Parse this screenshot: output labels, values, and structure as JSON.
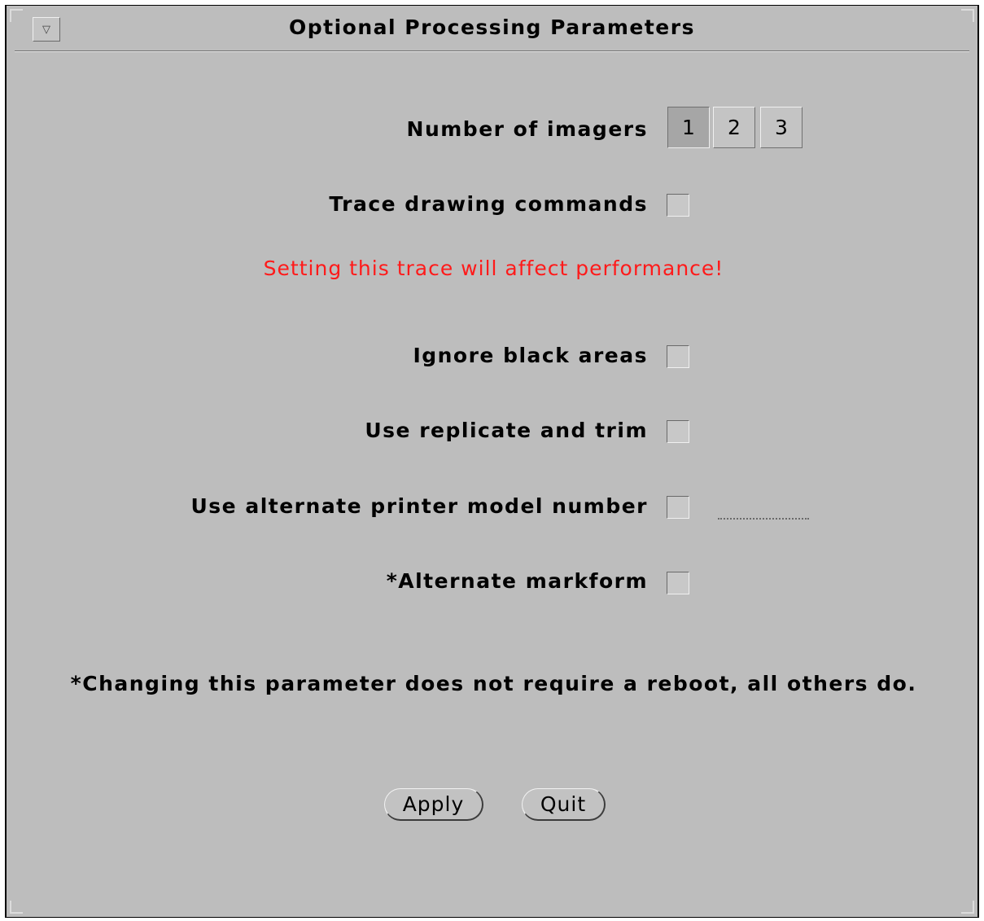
{
  "window": {
    "title": "Optional Processing Parameters",
    "menu_icon": "triangle-down-icon"
  },
  "imagers": {
    "label": "Number of imagers",
    "options": [
      "1",
      "2",
      "3"
    ],
    "selected": "1"
  },
  "trace": {
    "label": "Trace drawing commands",
    "checked": false,
    "warning": "Setting this trace will affect performance!",
    "warning_color": "#ff1a1a"
  },
  "ignore_black": {
    "label": "Ignore black areas",
    "checked": false
  },
  "replicate_trim": {
    "label": "Use replicate and trim",
    "checked": false
  },
  "alt_printer": {
    "label": "Use alternate printer model number",
    "checked": false,
    "value": ""
  },
  "alt_markform": {
    "label": "*Alternate markform",
    "checked": false
  },
  "footnote": "*Changing this parameter does not require a reboot, all others do.",
  "buttons": {
    "apply": "Apply",
    "quit": "Quit"
  }
}
